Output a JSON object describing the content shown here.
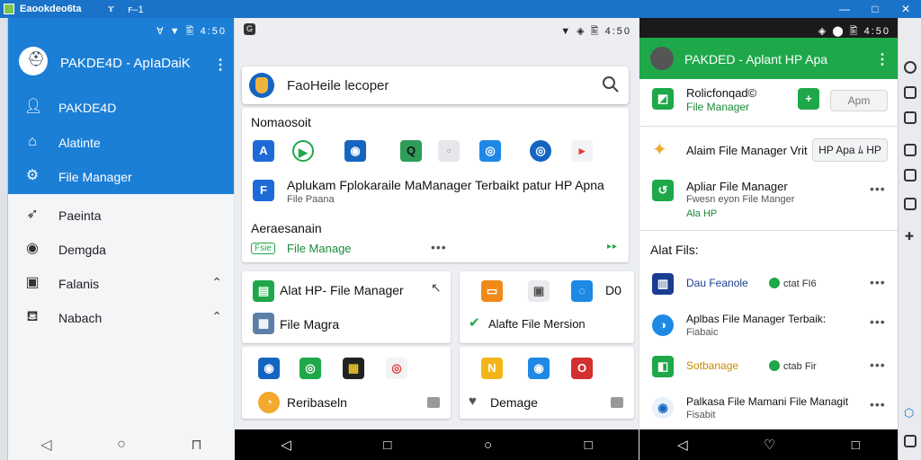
{
  "window": {
    "title": "Ea‍ookdeo‍6ta",
    "title_icons": [
      "ɤ",
      "ꜰ–1"
    ],
    "controls": [
      "—",
      "□",
      "✕"
    ]
  },
  "status": {
    "time1": "Ɐ ▼ 🖺 4:50",
    "time2": "▼ ◈ 🖺 4:50",
    "time3": "◈ ⬤ 🖺 4:50"
  },
  "panel1": {
    "title": "PAKDE4D - ApIaDaiK",
    "nav_primary": [
      {
        "label": "PAKDE4D",
        "icon": "person-icon"
      },
      {
        "label": "Alatinte",
        "icon": "home-icon"
      },
      {
        "label": "File Manager",
        "icon": "settings-icon"
      }
    ],
    "nav_secondary": [
      {
        "label": "Paeinta",
        "icon": "pin-icon"
      },
      {
        "label": "Demgda",
        "icon": "circle-icon"
      },
      {
        "label": "Falanis",
        "icon": "square-icon"
      },
      {
        "label": "Nabach",
        "icon": "folder-icon"
      }
    ],
    "nav_buttons": [
      "◁",
      "○",
      "⊓"
    ]
  },
  "panel2": {
    "search": {
      "text": "FaoHeile lecoper"
    },
    "section1": {
      "heading": "Nomaosoit"
    },
    "app_row1": [
      "A",
      "▶",
      "◉",
      "Q",
      "▫",
      "◎",
      "◎",
      "▸"
    ],
    "item": {
      "title": "Aplukam Fplokaraile MaManager Terbaikt  patur HP Apna",
      "sub": "File Paana"
    },
    "section2": {
      "heading": "Aeraesanain",
      "badge": "Fsie",
      "link": "File Manage",
      "more": "•••"
    },
    "card_left": {
      "title": "Alat HP- File Manager",
      "sub": "File Magra",
      "icons": [
        "◉",
        "◎",
        "▦",
        "◎"
      ],
      "bottom": "Reribaseln"
    },
    "card_right": {
      "icons": [
        "▭",
        "▣",
        "◌"
      ],
      "top_label": "D0",
      "sub": "Alafte File Mersion",
      "bottom_icons": [
        "N",
        "◉",
        "O"
      ],
      "bottom": "Demage"
    },
    "nav_buttons": [
      "◁",
      "□",
      "○",
      "□"
    ]
  },
  "panel3": {
    "title": "PAKDED - Aplant HP Apa",
    "row1": {
      "title": "Rolicfonqad©",
      "sub": "File Manager",
      "button": "Apm"
    },
    "row2": {
      "title": "Alaim File Manager Vrit",
      "pill": "HP Apa ﾑ HP"
    },
    "row3": {
      "title": "Apliar File Manager",
      "sub": "Fwesn eyon File Manger",
      "tag": "Ala HP"
    },
    "section": "Alat Fils:",
    "list": [
      {
        "title": "Dau Feanole",
        "tag": "ctat FI6",
        "sub": ""
      },
      {
        "title": "Aplbas File Manager Terbaik:",
        "tag": "",
        "sub": "Fiabaic"
      },
      {
        "title": "Sotbanage",
        "tag": "ctab Fir",
        "sub": ""
      },
      {
        "title": "Palkasa File Mamani File Managit",
        "tag": "",
        "sub": "Fisabit"
      }
    ],
    "more": "•••",
    "nav_buttons": [
      "◁",
      "♡",
      "□"
    ]
  },
  "colors": {
    "blue": "#1c7fd6",
    "green": "#1ea84a",
    "titlebar": "#1a73c9"
  }
}
